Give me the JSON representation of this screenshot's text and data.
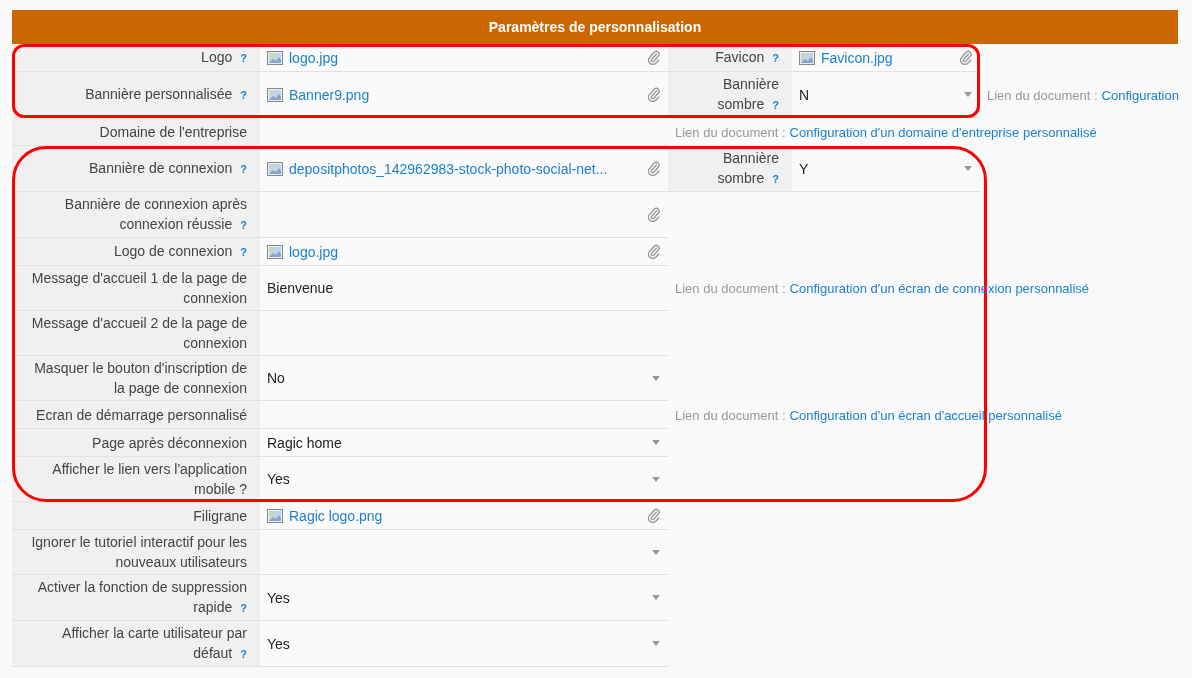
{
  "header": {
    "title": "Paramètres de personnalisation"
  },
  "sections": [
    {
      "highlighted": true,
      "rows": [
        {
          "label": "Logo",
          "help": "?",
          "kind": "file",
          "value": "logo.jpg",
          "side": {
            "label": "Favicon",
            "help": "?",
            "kind": "file",
            "value": "Favicon.jpg"
          }
        },
        {
          "label": "Bannière personnalisée",
          "help": "?",
          "kind": "file",
          "value": "Banner9.png",
          "side": {
            "label": "Bannière sombre",
            "help": "?",
            "kind": "select",
            "value": "N"
          },
          "doc": {
            "label": "Lien du document :",
            "link": "Configuration"
          }
        }
      ]
    },
    {
      "highlighted": false,
      "rows": [
        {
          "label": "Domaine de l'entreprise",
          "kind": "text",
          "doc": {
            "label": "Lien du document :",
            "link": "Configuration d'un domaine d'entreprise personnalisé"
          }
        }
      ]
    },
    {
      "highlighted": true,
      "rows": [
        {
          "label": "Bannière de connexion",
          "help": "?",
          "kind": "file",
          "value": "depositphotos_142962983-stock-photo-social-net...",
          "side": {
            "label": "Bannière sombre",
            "help": "?",
            "kind": "select",
            "value": "Y"
          }
        },
        {
          "label": "Bannière de connexion après connexion réussie",
          "help": "?",
          "kind": "file"
        },
        {
          "label": "Logo de connexion",
          "help": "?",
          "kind": "file",
          "value": "logo.jpg"
        },
        {
          "label": "Message d'accueil 1 de la page de connexion",
          "kind": "text",
          "value": "Bienvenue",
          "doc": {
            "label": "Lien du document :",
            "link": "Configuration d'un écran de connexion personnalisé"
          }
        },
        {
          "label": "Message d'accueil 2 de la page de connexion",
          "kind": "text"
        },
        {
          "label": "Masquer le bouton d'inscription de la page de connexion",
          "kind": "select",
          "value": "No"
        },
        {
          "label": "Ecran de démarrage personnalisé",
          "kind": "text",
          "doc": {
            "label": "Lien du document :",
            "link": "Configuration d'un écran d'accueil personnalisé"
          }
        },
        {
          "label": "Page après déconnexion",
          "kind": "select",
          "value": "Ragic home"
        },
        {
          "label": "Afficher le lien vers l'application mobile ?",
          "kind": "select",
          "value": "Yes"
        }
      ]
    },
    {
      "highlighted": false,
      "rows": [
        {
          "label": "Filigrane",
          "kind": "file",
          "value": "Ragic logo.png"
        },
        {
          "label": "Ignorer le tutoriel interactif pour les nouveaux utilisateurs",
          "kind": "select"
        },
        {
          "label": "Activer la fonction de suppression rapide",
          "help": "?",
          "kind": "select",
          "value": "Yes"
        },
        {
          "label": "Afficher la carte utilisateur par défaut",
          "help": "?",
          "kind": "select",
          "value": "Yes"
        }
      ]
    }
  ]
}
